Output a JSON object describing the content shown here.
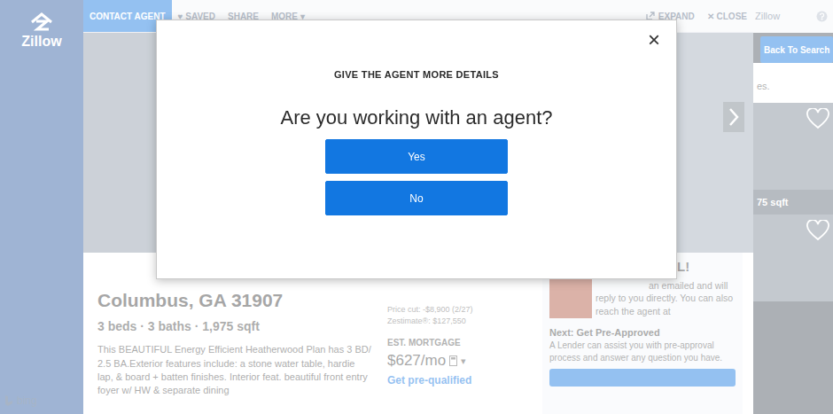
{
  "sidebar": {
    "logo": "Zillow",
    "footer": "bing"
  },
  "topbar": {
    "left": [
      {
        "label": "CONTACT AGENT",
        "selected": true
      },
      {
        "label": "♥ SAVED",
        "selected": false
      },
      {
        "label": "SHARE",
        "selected": false
      },
      {
        "label": "MORE ▾",
        "selected": false
      }
    ],
    "right": [
      {
        "kind": "expand",
        "label": "EXPAND"
      },
      {
        "kind": "close",
        "label": "✕ CLOSE"
      }
    ]
  },
  "right_panel": {
    "brand": "Zillow",
    "back": "Back To Search",
    "snippets": [
      "es.",
      "75 sqft"
    ]
  },
  "listing": {
    "address": "Columbus, GA 31907",
    "facts": "3 beds · 3 baths · 1,975 sqft",
    "description": "This BEAUTIFUL Energy Efficient Heatherwood Plan has 3 BD/ 2.5 BA.Exterior features include: a stone water table, hardie lap, & board + batten finishes. Interior feat. beautiful front entry foyer w/ HW & separate dining",
    "price_cut": "Price cut: -$8,900 (2/27)",
    "zestimate": "Zestimate®: $127,550",
    "mortgage_label": "EST. MORTGAGE",
    "mortgage": "$627/mo",
    "mortgage_menu": "▾",
    "prequalify": "Get pre-qualified"
  },
  "agent": {
    "title": "SFUL!",
    "message": "an emailed and will reply to you directly. You can also reach the agent at",
    "next_title": "Next: Get Pre-Approved",
    "next_text": "A Lender can assist you with pre-approval process and answer any question you have."
  },
  "modal": {
    "close": "×",
    "kicker": "GIVE THE AGENT MORE DETAILS",
    "question": "Are you working with an agent?",
    "buttons": [
      {
        "label": "Yes"
      },
      {
        "label": "No"
      }
    ]
  }
}
